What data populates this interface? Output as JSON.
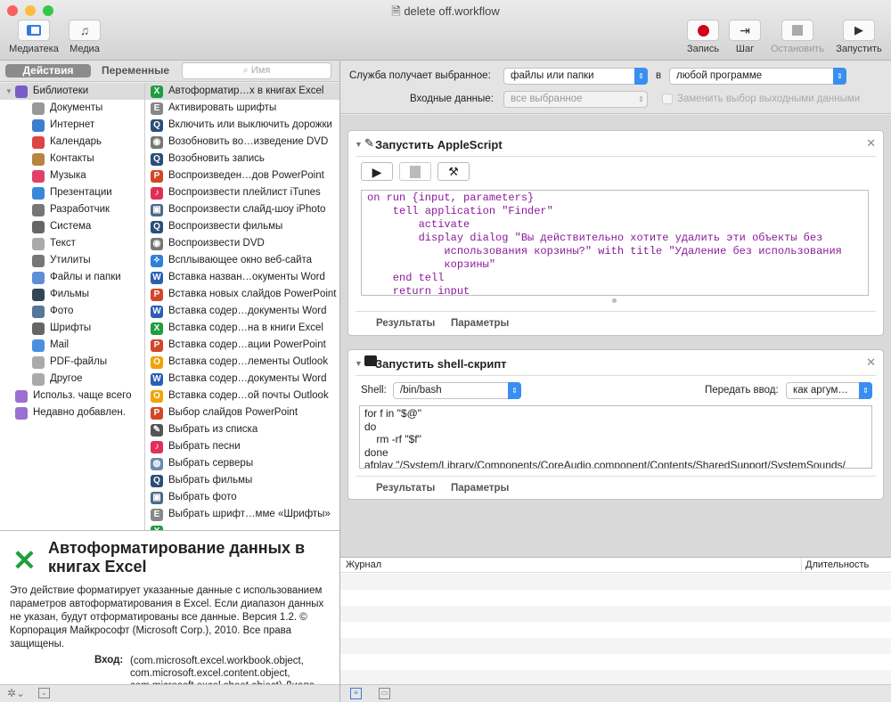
{
  "window": {
    "title": "delete off.workflow"
  },
  "toolbar": {
    "library": "Медиатека",
    "media": "Медиа",
    "record": "Запись",
    "step": "Шаг",
    "stop": "Остановить",
    "run": "Запустить"
  },
  "tabs": {
    "actions": "Действия",
    "variables": "Переменные",
    "search_placeholder": "Имя"
  },
  "library": [
    {
      "label": "Библиотеки",
      "color": "#7b5cc8",
      "top": true
    },
    {
      "label": "Документы",
      "color": "#999"
    },
    {
      "label": "Интернет",
      "color": "#3b7fd0"
    },
    {
      "label": "Календарь",
      "color": "#d44"
    },
    {
      "label": "Контакты",
      "color": "#b8843f"
    },
    {
      "label": "Музыка",
      "color": "#e0406a"
    },
    {
      "label": "Презентации",
      "color": "#3a88d8"
    },
    {
      "label": "Разработчик",
      "color": "#777"
    },
    {
      "label": "Система",
      "color": "#666"
    },
    {
      "label": "Текст",
      "color": "#aaa"
    },
    {
      "label": "Утилиты",
      "color": "#777"
    },
    {
      "label": "Файлы и папки",
      "color": "#5b8fd8"
    },
    {
      "label": "Фильмы",
      "color": "#345"
    },
    {
      "label": "Фото",
      "color": "#579"
    },
    {
      "label": "Шрифты",
      "color": "#666"
    },
    {
      "label": "Mail",
      "color": "#4a90e2"
    },
    {
      "label": "PDF-файлы",
      "color": "#aaa"
    },
    {
      "label": "Другое",
      "color": "#aaa"
    },
    {
      "label": "Использ. чаще всего",
      "color": "#9b6fd0",
      "top": true
    },
    {
      "label": "Недавно добавлен.",
      "color": "#9b6fd0",
      "top": true
    }
  ],
  "actions": [
    {
      "label": "Автоформатир…х в книгах Excel",
      "icon": "excel",
      "selected": true
    },
    {
      "label": "Активировать шрифты",
      "icon": "font"
    },
    {
      "label": "Включить или выключить дорожки",
      "icon": "quicktime"
    },
    {
      "label": "Возобновить во…изведение DVD",
      "icon": "dvd"
    },
    {
      "label": "Возобновить запись",
      "icon": "quicktime"
    },
    {
      "label": "Воспроизведен…дов PowerPoint",
      "icon": "powerpoint"
    },
    {
      "label": "Воспроизвести плейлист iTunes",
      "icon": "itunes"
    },
    {
      "label": "Воспроизвести слайд-шоу iPhoto",
      "icon": "iphoto"
    },
    {
      "label": "Воспроизвести фильмы",
      "icon": "quicktime"
    },
    {
      "label": "Воспроизвести DVD",
      "icon": "dvd"
    },
    {
      "label": "Всплывающее окно веб-сайта",
      "icon": "safari"
    },
    {
      "label": "Вставка назван…окументы Word",
      "icon": "word"
    },
    {
      "label": "Вставка новых слайдов PowerPoint",
      "icon": "powerpoint"
    },
    {
      "label": "Вставка содер…документы Word",
      "icon": "word"
    },
    {
      "label": "Вставка содер…на в книги Excel",
      "icon": "excel"
    },
    {
      "label": "Вставка содер…ации PowerPoint",
      "icon": "powerpoint"
    },
    {
      "label": "Вставка содер…лементы Outlook",
      "icon": "outlook"
    },
    {
      "label": "Вставка содер…документы Word",
      "icon": "word"
    },
    {
      "label": "Вставка содер…ой почты Outlook",
      "icon": "outlook"
    },
    {
      "label": "Выбор слайдов PowerPoint",
      "icon": "powerpoint"
    },
    {
      "label": "Выбрать из списка",
      "icon": "script"
    },
    {
      "label": "Выбрать песни",
      "icon": "itunes"
    },
    {
      "label": "Выбрать серверы",
      "icon": "network"
    },
    {
      "label": "Выбрать фильмы",
      "icon": "quicktime"
    },
    {
      "label": "Выбрать фото",
      "icon": "iphoto"
    },
    {
      "label": "Выбрать шрифт…мме «Шрифты»",
      "icon": "font"
    },
    {
      "label": "",
      "icon": "excel"
    }
  ],
  "icon_colors": {
    "excel": "#1e9e3e",
    "font": "#888",
    "quicktime": "#2a4f7a",
    "dvd": "#777",
    "powerpoint": "#d24726",
    "itunes": "#e0305a",
    "iphoto": "#4a6a8a",
    "safari": "#2f80d8",
    "word": "#2b5eb5",
    "outlook": "#f0a30a",
    "script": "#555",
    "network": "#6a8ab0"
  },
  "description": {
    "title": "Автоформатирование данных в книгах Excel",
    "body": "Это действие форматирует указанные данные с использованием параметров автоформатирования в Excel. Если диапазон данных не указан, будут отформатированы все данные. Версия 1.2. © Корпорация Майкрософт (Microsoft Corp.), 2010. Все права защищены.",
    "input_label": "Вход:",
    "input_value": "(com.microsoft.excel.workbook.object, com.microsoft.excel.content.object, com.microsoft.excel.sheet.object) Диапа"
  },
  "config": {
    "receives_label": "Служба получает выбранное:",
    "receives_value": "файлы или папки",
    "in_label": "в",
    "app_value": "любой программе",
    "input_label": "Входные данные:",
    "input_value": "все выбранное",
    "replace_label": "Заменить выбор выходными данными"
  },
  "applescript": {
    "title": "Запустить AppleScript",
    "code": "on run {input, parameters}\n    tell application \"Finder\"\n        activate\n        display dialog \"Вы действительно хотите удалить эти объекты без\n            использования корзины?\" with title \"Удаление без использования\n            корзины\"\n    end tell\n    return input\nend run",
    "results": "Результаты",
    "options": "Параметры"
  },
  "shell": {
    "title": "Запустить shell-скрипт",
    "shell_label": "Shell:",
    "shell_value": "/bin/bash",
    "pass_label": "Передать ввод:",
    "pass_value": "как аргум…",
    "code": "for f in \"$@\"\ndo\n    rm -rf \"$f\"\ndone\nafplay \"/System/Library/Components/CoreAudio.component/Contents/SharedSupport/SystemSounds/",
    "results": "Результаты",
    "options": "Параметры"
  },
  "log": {
    "col_log": "Журнал",
    "col_duration": "Длительность"
  }
}
